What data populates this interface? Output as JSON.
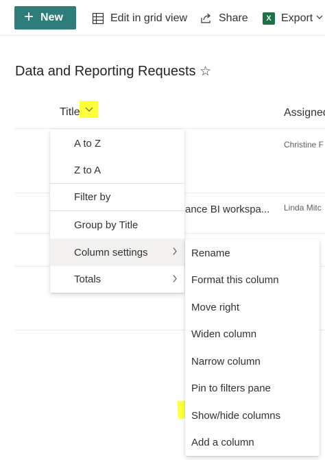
{
  "toolbar": {
    "new_label": "New",
    "edit_grid_label": "Edit in grid view",
    "share_label": "Share",
    "export_label": "Export",
    "excel_glyph": "X"
  },
  "list": {
    "title": "Data and Reporting Requests",
    "columns": {
      "title": "Title",
      "assigned": "Assigned"
    },
    "rows": [
      {
        "title": "",
        "assigned": "Christine F"
      },
      {
        "title": "ance BI workspa...",
        "assigned": "Linda Mitc"
      },
      {
        "title": "",
        "assigned": ""
      },
      {
        "title": "",
        "assigned": ""
      }
    ]
  },
  "column_menu": {
    "items": [
      {
        "label": "A to Z"
      },
      {
        "label": "Z to A"
      },
      {
        "label": "Filter by"
      },
      {
        "label": "Group by Title"
      },
      {
        "label": "Column settings",
        "has_submenu": true,
        "active": true
      },
      {
        "label": "Totals",
        "has_submenu": true
      }
    ]
  },
  "column_settings_menu": {
    "items": [
      {
        "label": "Rename"
      },
      {
        "label": "Format this column"
      },
      {
        "label": "Move right"
      },
      {
        "label": "Widen column"
      },
      {
        "label": "Narrow column"
      },
      {
        "label": "Pin to filters pane"
      },
      {
        "label": "Show/hide columns",
        "highlighted": true
      },
      {
        "label": "Add a column"
      }
    ]
  },
  "colors": {
    "accent": "#2e7d7a",
    "highlight": "#ffff3a",
    "excel": "#1e7145"
  },
  "icons": {
    "new": "plus-icon",
    "grid": "grid-icon",
    "share": "share-icon",
    "export": "excel-icon",
    "favorite": "star-icon",
    "column_dropdown": "chevron-down-icon",
    "submenu": "chevron-right-icon"
  }
}
